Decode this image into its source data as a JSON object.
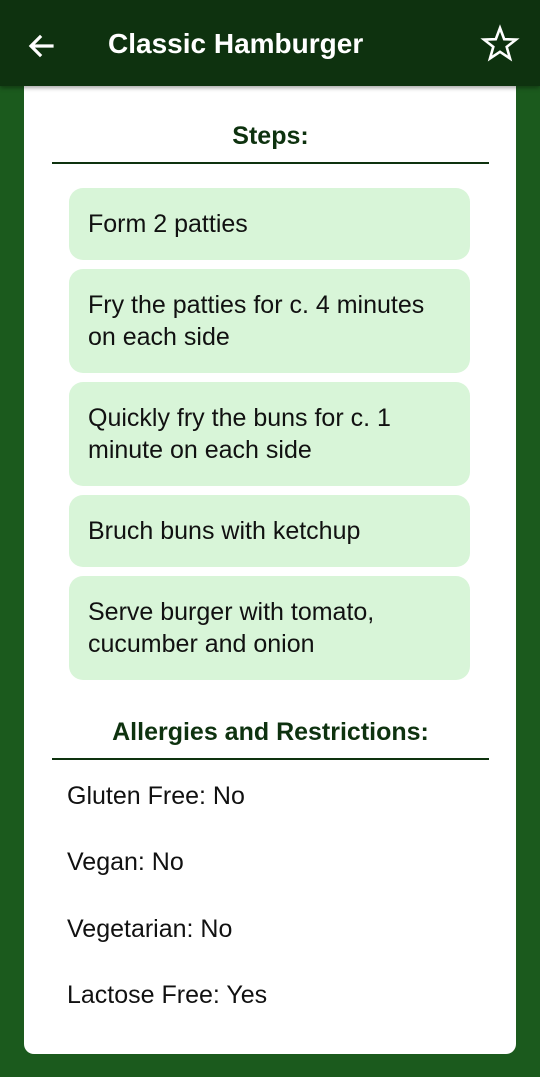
{
  "header": {
    "title": "Classic Hamburger"
  },
  "icons": {
    "back": "arrow-back-icon",
    "favorite": "star-outline-icon"
  },
  "colors": {
    "app_bar": "#0e320f",
    "background": "#1b5a1d",
    "step_bg": "#d8f5d8",
    "heading": "#0e320f"
  },
  "steps_section": {
    "heading": "Steps:",
    "items": [
      "Form 2 patties",
      "Fry the patties for c. 4 minutes on each side",
      "Quickly fry the buns for c. 1 minute on each side",
      "Bruch buns with ketchup",
      "Serve burger with tomato, cucumber and onion"
    ]
  },
  "allergies_section": {
    "heading": "Allergies and Restrictions:",
    "items": [
      "Gluten Free: No",
      "Vegan: No",
      "Vegetarian: No",
      "Lactose Free: Yes"
    ]
  }
}
